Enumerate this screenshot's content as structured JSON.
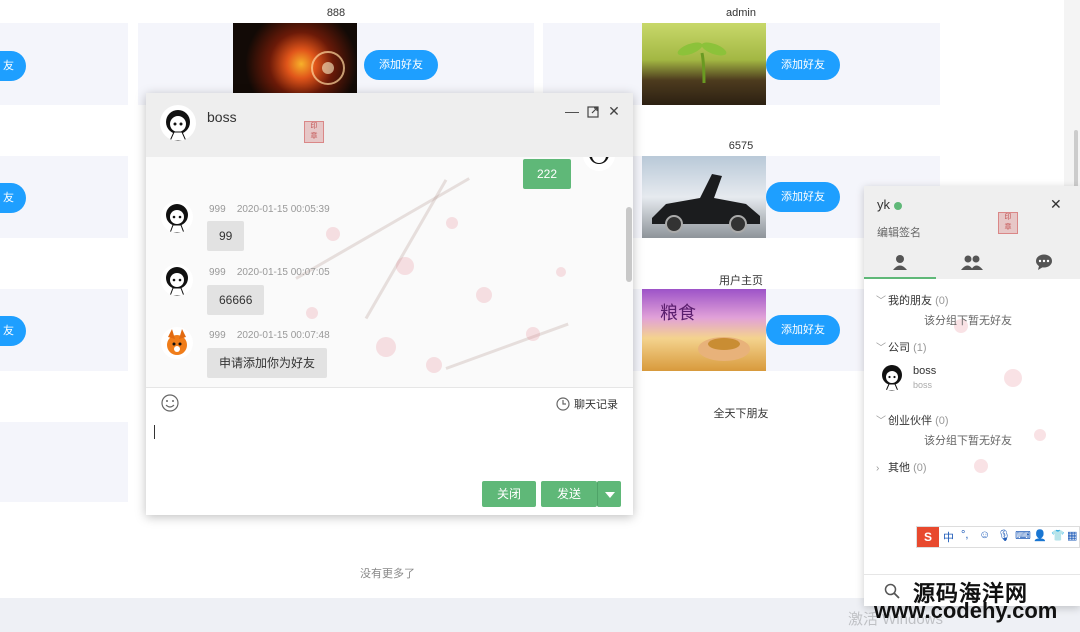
{
  "users": [
    {
      "name": "888",
      "add_label": "添加好友"
    },
    {
      "name": "admin",
      "add_label": "添加好友"
    },
    {
      "name": "6575",
      "add_label": "添加好友"
    },
    {
      "name": "用户主页",
      "add_label": "添加好友"
    },
    {
      "name": "全天下朋友"
    }
  ],
  "left_add_label": "友",
  "footer": {
    "no_more": "没有更多了"
  },
  "chat": {
    "title": "boss",
    "my_message": "222",
    "messages": [
      {
        "sender": "999",
        "time": "2020-01-15 00:05:39",
        "text": "99"
      },
      {
        "sender": "999",
        "time": "2020-01-15 00:07:05",
        "text": "66666"
      },
      {
        "sender": "999",
        "time": "2020-01-15 00:07:48",
        "text": "申请添加你为好友"
      }
    ],
    "history_label": "聊天记录",
    "close_label": "关闭",
    "send_label": "发送"
  },
  "panel": {
    "username": "yk",
    "signature_placeholder": "编辑签名",
    "groups": [
      {
        "name": "我的朋友",
        "count": "(0)",
        "empty": "该分组下暂无好友"
      },
      {
        "name": "公司",
        "count": "(1)"
      },
      {
        "name": "创业伙伴",
        "count": "(0)",
        "empty": "该分组下暂无好友"
      },
      {
        "name": "其他",
        "count": "(0)"
      }
    ],
    "friend": {
      "name": "boss",
      "signature": "boss"
    },
    "ime": {
      "logo": "S",
      "lang": "中",
      "punct": "°,"
    }
  },
  "watermark": {
    "site_name": "源码海洋网",
    "site_url": "www.codehy.com",
    "windows_text": "激活 Windows"
  },
  "colors": {
    "accent_blue": "#1e9fff",
    "accent_green": "#5fb878"
  },
  "icons": [
    "minimize-icon",
    "maximize-icon",
    "close-icon",
    "emoji-icon",
    "clock-icon",
    "person-icon",
    "group-icon",
    "chat-icon",
    "search-icon"
  ]
}
